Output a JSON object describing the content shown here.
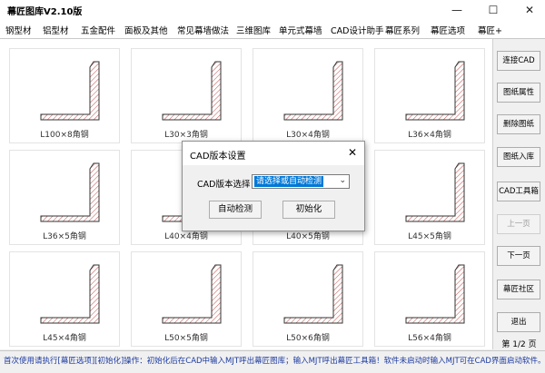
{
  "window": {
    "title": "幕匠图库V2.10版",
    "controls": {
      "minimize": "—",
      "maximize": "☐",
      "close": "✕"
    }
  },
  "menu": [
    "钢型材",
    "铝型材",
    "五金配件",
    "面板及其他",
    "常见幕墙做法",
    "三维图库",
    "单元式幕墙",
    "CAD设计助手",
    "幕匠系列",
    "幕匠选项",
    "幕匠+"
  ],
  "gallery": {
    "items": [
      {
        "label": "L100×8角钢",
        "icon": "angle-steel-icon"
      },
      {
        "label": "L30×3角钢",
        "icon": "angle-steel-icon"
      },
      {
        "label": "L30×4角钢",
        "icon": "angle-steel-icon"
      },
      {
        "label": "L36×4角钢",
        "icon": "angle-steel-icon"
      },
      {
        "label": "L36×5角钢",
        "icon": "angle-steel-icon"
      },
      {
        "label": "L40×4角钢",
        "icon": "angle-steel-icon"
      },
      {
        "label": "L40×5角钢",
        "icon": "angle-steel-icon"
      },
      {
        "label": "L45×5角钢",
        "icon": "angle-steel-icon"
      },
      {
        "label": "L45×4角钢",
        "icon": "angle-steel-icon"
      },
      {
        "label": "L50×5角钢",
        "icon": "angle-steel-icon"
      },
      {
        "label": "L50×6角钢",
        "icon": "angle-steel-icon"
      },
      {
        "label": "L56×4角钢",
        "icon": "angle-steel-icon"
      }
    ]
  },
  "sidebar": {
    "buttons": [
      {
        "label": "连接CAD",
        "enabled": true
      },
      {
        "label": "图纸属性",
        "enabled": true
      },
      {
        "label": "删除图纸",
        "enabled": true
      },
      {
        "label": "图纸入库",
        "enabled": true
      },
      {
        "label": "CAD工具箱",
        "enabled": true
      },
      {
        "label": "上一页",
        "enabled": false
      },
      {
        "label": "下一页",
        "enabled": true
      },
      {
        "label": "幕匠社区",
        "enabled": true
      },
      {
        "label": "退出",
        "enabled": true
      }
    ],
    "page_info": "第 1/2 页"
  },
  "status": "首次使用请执行[幕匠选项][初始化]操作：初始化后在CAD中输入MJT呼出幕匠图库；输入MJT呼出幕匠工具箱！软件未启动时输入MJT可在CAD界面启动软件。",
  "dialog": {
    "title": "CAD版本设置",
    "close": "✕",
    "version_label": "CAD版本选择：",
    "version_value": "请选择或自动检测",
    "auto_detect": "自动检测",
    "initialize": "初始化"
  },
  "colors": {
    "hatch": "#c0504d",
    "selection": "#0078d7",
    "status_text": "#1c3aa0"
  }
}
